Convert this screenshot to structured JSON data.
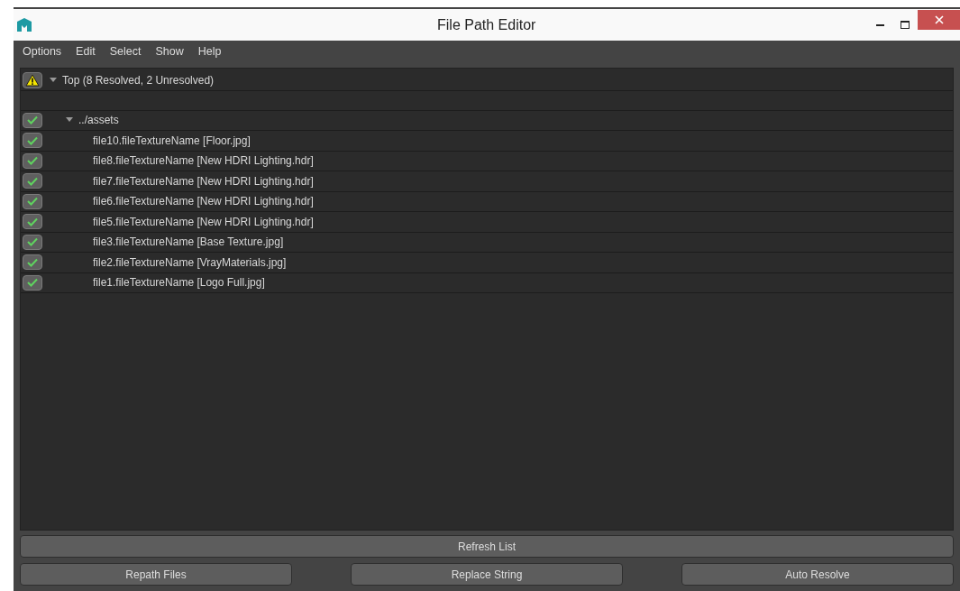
{
  "window": {
    "title": "File Path Editor"
  },
  "menu": [
    "Options",
    "Edit",
    "Select",
    "Show",
    "Help"
  ],
  "tree": [
    {
      "label": "Top (8 Resolved, 2 Unresolved)",
      "resolved": false,
      "expanded": true,
      "children": [
        {
          "label": "../assets",
          "resolved": true,
          "expanded": true,
          "children": [
            {
              "label": "file10.fileTextureName [Floor.jpg]",
              "resolved": true
            },
            {
              "label": "file8.fileTextureName [New HDRI Lighting.hdr]",
              "resolved": true
            },
            {
              "label": "file7.fileTextureName [New HDRI Lighting.hdr]",
              "resolved": true
            },
            {
              "label": "file6.fileTextureName [New HDRI Lighting.hdr]",
              "resolved": true
            },
            {
              "label": "file5.fileTextureName [New HDRI Lighting.hdr]",
              "resolved": true
            },
            {
              "label": "file3.fileTextureName [Base Texture.jpg]",
              "resolved": true
            },
            {
              "label": "file2.fileTextureName [VrayMaterials.jpg]",
              "resolved": true
            },
            {
              "label": "file1.fileTextureName [Logo Full.jpg]",
              "resolved": true
            }
          ]
        }
      ]
    }
  ],
  "refresh_button": "Refresh List",
  "buttons": [
    "Repath Files",
    "Replace String",
    "Auto Resolve"
  ]
}
